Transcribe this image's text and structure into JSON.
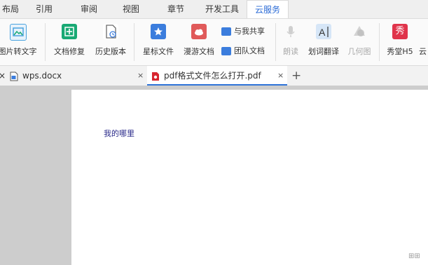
{
  "menu": {
    "items": [
      {
        "label": "布局"
      },
      {
        "label": "引用"
      },
      {
        "label": "审阅"
      },
      {
        "label": "视图"
      },
      {
        "label": "章节"
      },
      {
        "label": "开发工具"
      },
      {
        "label": "云服务",
        "active": true
      }
    ]
  },
  "ribbon": {
    "pic_to_text": "图片转文字",
    "doc_repair": "文档修复",
    "history": "历史版本",
    "star_files": "星标文件",
    "roam_docs": "漫游文档",
    "shared_with_me": "与我共享",
    "team_docs": "团队文档",
    "read_aloud": "朗读",
    "word_translate": "划词翻译",
    "geometry": "几何图",
    "xiutang": "秀堂H5",
    "cloud": "云",
    "colors": {
      "pic_to_text": "#4aa3df",
      "doc_repair": "#19a974",
      "history": "#6b6b6b",
      "star_files": "#3b7ddd",
      "roam_docs": "#e05a5a",
      "shared_with_me": "#3b7ddd",
      "team_docs": "#3b7ddd",
      "disabled": "#bdbdbd",
      "xiutang": "#e0344b"
    }
  },
  "tabs": {
    "left_close": "×",
    "items": [
      {
        "title": "wps.docx",
        "icon": "word-doc-icon",
        "close": "×"
      },
      {
        "title": "pdf格式文件怎么打开.pdf",
        "icon": "pdf-doc-icon",
        "close": "×",
        "active": true
      }
    ],
    "new_tab": "+"
  },
  "document": {
    "text": "我的哪里"
  },
  "watermark": "⊞⊞"
}
